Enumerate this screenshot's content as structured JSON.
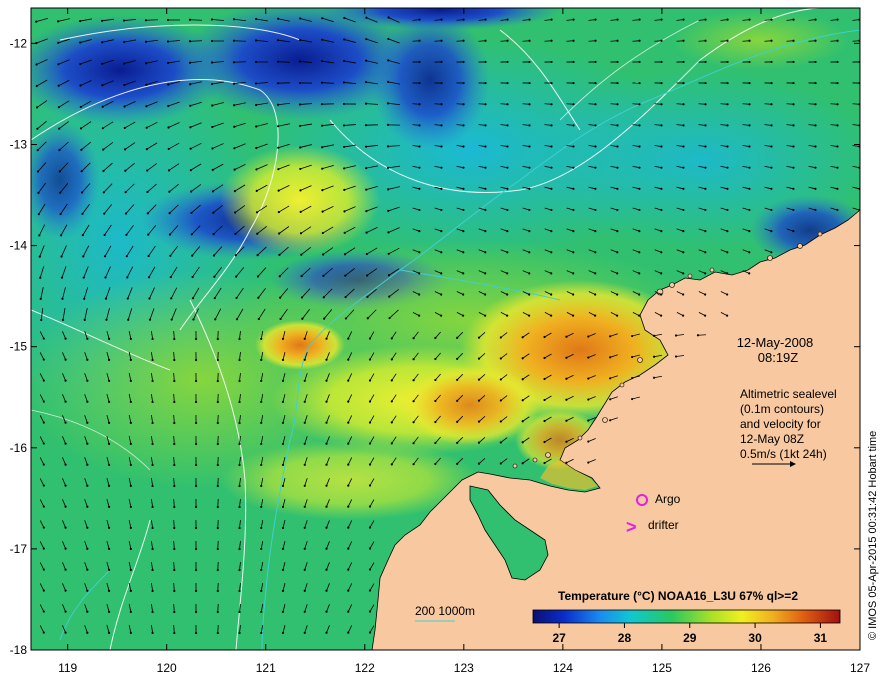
{
  "map": {
    "date": "12-May-2008",
    "time": "08:19Z",
    "altimetry_lines": [
      "Altimetric sealevel",
      "(0.1m contours)",
      "and velocity for",
      "12-May 08Z",
      "0.5m/s (1kt 24h)"
    ],
    "legend_argo": "Argo",
    "legend_drifter": "drifter",
    "drifter_symbol": ">",
    "depth_contours_label": "200 1000m",
    "credit": "© IMOS 05-Apr-2015 00:31:42 Hobart time",
    "lon_ticks": [
      "119",
      "120",
      "121",
      "122",
      "123",
      "124",
      "125",
      "126",
      "127"
    ],
    "lat_ticks": [
      "-12",
      "-13",
      "-14",
      "-15",
      "-16",
      "-17",
      "-18"
    ],
    "lon_range": [
      118.63,
      127.0
    ],
    "lat_range": [
      -11.65,
      -18.0
    ],
    "colorbar": {
      "title": "Temperature (°C) NOAA16_L3U 67% ql>=2",
      "ticks": [
        "27",
        "28",
        "29",
        "30",
        "31"
      ],
      "range": [
        26.6,
        31.3
      ]
    },
    "colors": {
      "land": "#f8c8a0",
      "sea_mid": "#3cc878",
      "cool": "#1a30c8",
      "warm": "#e89028",
      "argo": "#e020e0",
      "drifter": "#e020e0",
      "contour_200": "#40d0d0",
      "contour_1000": "#ffffff"
    }
  }
}
